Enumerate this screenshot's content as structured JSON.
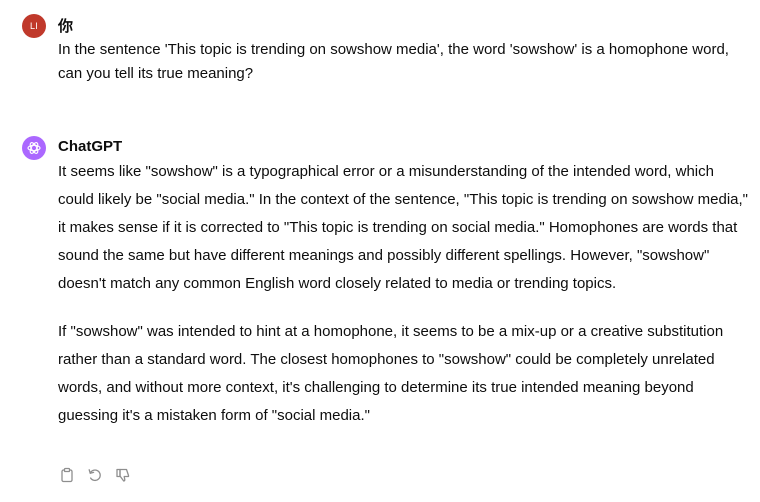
{
  "user_message": {
    "avatar_initials": "LI",
    "author": "你",
    "text": "In the sentence 'This topic is trending on sowshow media', the word 'sowshow' is a homophone word, can you tell its true meaning?"
  },
  "assistant_message": {
    "author": "ChatGPT",
    "paragraphs": [
      "It seems like \"sowshow\" is a typographical error or a misunderstanding of the intended word, which could likely be \"social media.\" In the context of the sentence, \"This topic is trending on sowshow media,\" it makes sense if it is corrected to \"This topic is trending on social media.\" Homophones are words that sound the same but have different meanings and possibly different spellings. However, \"sowshow\" doesn't match any common English word closely related to media or trending topics.",
      "If \"sowshow\" was intended to hint at a homophone, it seems to be a mix-up or a creative substitution rather than a standard word. The closest homophones to \"sowshow\" could be completely unrelated words, and without more context, it's challenging to determine its true intended meaning beyond guessing it's a mistaken form of \"social media.\""
    ],
    "actions": [
      "copy-icon",
      "regenerate-icon",
      "thumbs-down-icon"
    ]
  },
  "colors": {
    "user_avatar": "#c0392b",
    "assistant_avatar": "#ab68ff",
    "text": "#0d0d0d",
    "icon": "#8e8e8e"
  }
}
